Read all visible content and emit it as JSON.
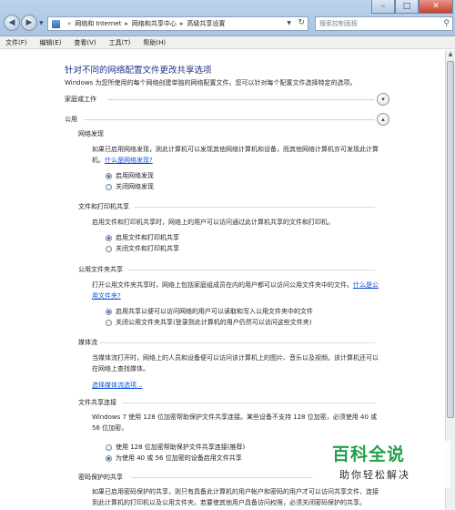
{
  "address_bar": {
    "crumbs": [
      "网络和 Internet",
      "网络和共享中心",
      "高级共享设置"
    ]
  },
  "search": {
    "placeholder": "搜索控制面板"
  },
  "menu": [
    "文件(F)",
    "编辑(E)",
    "查看(V)",
    "工具(T)",
    "帮助(H)"
  ],
  "page": {
    "title": "针对不同的网络配置文件更改共享选项",
    "description": "Windows 为您所使用的每个网络创建单独的网络配置文件。您可以针对每个配置文件选择特定的选项。"
  },
  "profiles": {
    "home_work": "家庭或工作",
    "public": "公用"
  },
  "sections": {
    "network_discovery": {
      "header": "网络发现",
      "text": "如果已启用网络发现，则此计算机可以发现其他网络计算机和设备，而其他网络计算机亦可发现此计算机。",
      "link": "什么是网络发现?",
      "options": [
        "启用网络发现",
        "关闭网络发现"
      ],
      "selected": 0
    },
    "file_printer": {
      "header": "文件和打印机共享",
      "text": "启用文件和打印机共享时，网络上的用户可以访问通过此计算机共享的文件和打印机。",
      "options": [
        "启用文件和打印机共享",
        "关闭文件和打印机共享"
      ],
      "selected": 0
    },
    "public_folder": {
      "header": "公用文件夹共享",
      "text": "打开公用文件夹共享时，网络上包括家庭组成员在内的用户都可以访问公用文件夹中的文件。",
      "link1": "什么",
      "link2": "是公用文件夹?",
      "options": [
        "启用共享以便可以访问网络的用户可以读取和写入公用文件夹中的文件",
        "关闭公用文件夹共享(登录到此计算机的用户仍然可以访问这些文件夹)"
      ],
      "selected": 0
    },
    "media": {
      "header": "媒体流",
      "text": "当媒体流打开时，网络上的人员和设备便可以访问该计算机上的图片、音乐以及视频。该计算机还可以在网络上查找媒体。",
      "link": "选择媒体流选项..."
    },
    "file_sharing_conn": {
      "header": "文件共享连接",
      "text": "Windows 7 使用 128 位加密帮助保护文件共享连接。某些设备不支持 128 位加密，必须使用 40 或 56 位加密。",
      "options": [
        "使用 128 位加密帮助保护文件共享连接(推荐)",
        "为使用 40 或 56 位加密的设备启用文件共享"
      ],
      "selected": 1
    },
    "password_sharing": {
      "header": "密码保护的共享",
      "text": "如果已启用密码保护的共享，则只有具备此计算机的用户帐户和密码的用户才可以访问共享文件、连接到此计算机的打印机以及公用文件夹。若要使其他用户具备访问权限，必须关闭密码保护的共享。"
    }
  },
  "watermark": {
    "main": "百科全说",
    "sub": "助你轻松解决"
  }
}
